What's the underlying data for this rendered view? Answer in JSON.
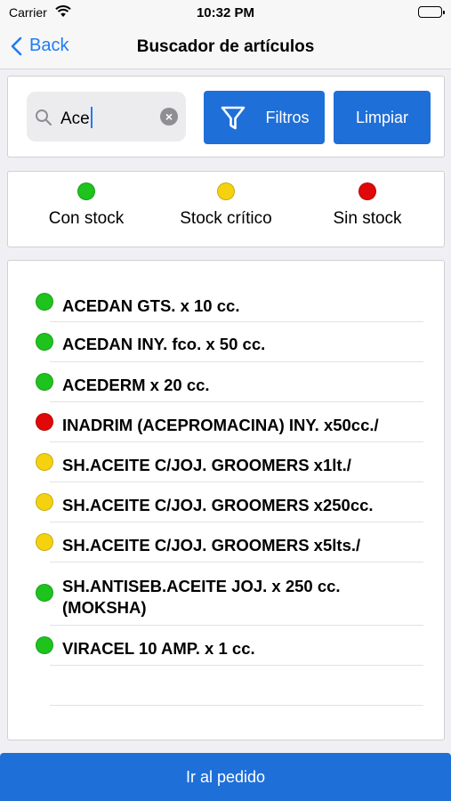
{
  "status": {
    "carrier": "Carrier",
    "time": "10:32 PM"
  },
  "nav": {
    "back_label": "Back",
    "title": "Buscador de artículos"
  },
  "search": {
    "value": "Ace",
    "filter_label": "Filtros",
    "clear_label": "Limpiar"
  },
  "legend": [
    {
      "label": "Con stock",
      "color": "#1ec31e"
    },
    {
      "label": "Stock crítico",
      "color": "#f4d20f"
    },
    {
      "label": "Sin stock",
      "color": "#e00808"
    }
  ],
  "products": [
    {
      "name": "ACEDAN GTS. x 10 cc.",
      "status": "Con stock"
    },
    {
      "name": "ACEDAN INY. fco. x 50 cc.",
      "status": "Con stock"
    },
    {
      "name": "ACEDERM x 20 cc.",
      "status": "Con stock"
    },
    {
      "name": "INADRIM (ACEPROMACINA) INY. x50cc./",
      "status": "Sin stock"
    },
    {
      "name": "SH.ACEITE C/JOJ. GROOMERS x1lt./",
      "status": "Stock crítico"
    },
    {
      "name": "SH.ACEITE C/JOJ. GROOMERS x250cc.",
      "status": "Stock crítico"
    },
    {
      "name": "SH.ACEITE C/JOJ. GROOMERS x5lts./",
      "status": "Stock crítico"
    },
    {
      "name_line1": "SH.ANTISEB.ACEITE JOJ. x 250 cc.",
      "name_line2": "(MOKSHA)",
      "status": "Con stock"
    },
    {
      "name": "VIRACEL 10 AMP. x 1 cc.",
      "status": "Con stock"
    }
  ],
  "footer": {
    "order_label": "Ir al pedido"
  },
  "colors": {
    "accent": "#1f6fd8",
    "link": "#1f7cf4"
  }
}
